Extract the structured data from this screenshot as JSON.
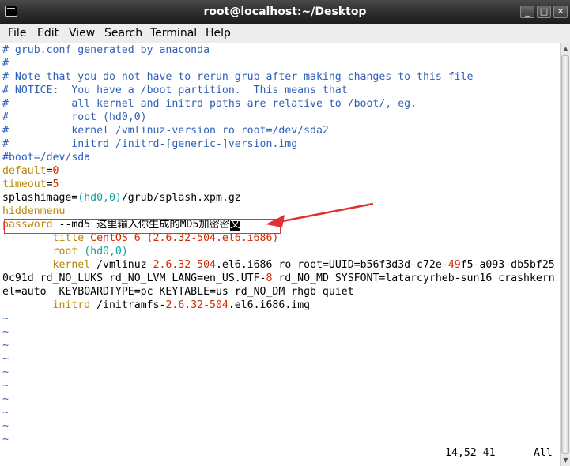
{
  "window": {
    "title": "root@localhost:~/Desktop",
    "controls": [
      "_",
      "□",
      "✕"
    ]
  },
  "menu": [
    "File",
    "Edit",
    "View",
    "Search",
    "Terminal",
    "Help"
  ],
  "lines": [
    [
      {
        "t": "# grub.conf generated by anaconda",
        "c": "c"
      }
    ],
    [
      {
        "t": "#",
        "c": "c"
      }
    ],
    [
      {
        "t": "# Note that you do not have to rerun grub after making changes to this file",
        "c": "c"
      }
    ],
    [
      {
        "t": "# NOTICE:  You have a /boot partition.  This means that",
        "c": "c"
      }
    ],
    [
      {
        "t": "#          all kernel and initrd paths are relative to /boot/, eg.",
        "c": "c"
      }
    ],
    [
      {
        "t": "#          root (hd0,0)",
        "c": "c"
      }
    ],
    [
      {
        "t": "#          kernel /vmlinuz-version ro root=/dev/sda2",
        "c": "c"
      }
    ],
    [
      {
        "t": "#          initrd /initrd-[generic-]version.img",
        "c": "c"
      }
    ],
    [
      {
        "t": "#boot=/dev/sda",
        "c": "c"
      }
    ],
    [
      {
        "t": "default",
        "c": "y"
      },
      {
        "t": "=",
        "c": ""
      },
      {
        "t": "0",
        "c": "m"
      }
    ],
    [
      {
        "t": "timeout",
        "c": "y"
      },
      {
        "t": "=",
        "c": ""
      },
      {
        "t": "5",
        "c": "m"
      }
    ],
    [
      {
        "t": "splashimage=",
        "c": ""
      },
      {
        "t": "(hd0,0)",
        "c": "t"
      },
      {
        "t": "/grub/splash.xpm.gz",
        "c": ""
      }
    ],
    [
      {
        "t": "hiddenmenu",
        "c": "y"
      }
    ],
    [
      {
        "t": "password",
        "c": "y"
      },
      {
        "t": " --md5 这里输入你生成的MD5加密密",
        "c": ""
      },
      {
        "t": "文",
        "c": "cur"
      }
    ],
    [
      {
        "t": "        ",
        "c": ""
      },
      {
        "t": "title",
        "c": "y"
      },
      {
        "t": " CentOS 6 (2.6.32-504.el6.i686)",
        "c": "m"
      }
    ],
    [
      {
        "t": "        ",
        "c": ""
      },
      {
        "t": "root",
        "c": "y"
      },
      {
        "t": " (hd0,0)",
        "c": "t"
      }
    ],
    [
      {
        "t": "        ",
        "c": ""
      },
      {
        "t": "kernel",
        "c": "y"
      },
      {
        "t": " /vmlinuz-",
        "c": ""
      },
      {
        "t": "2.6.32-504",
        "c": "m"
      },
      {
        "t": ".el6.i686 ro root=UUID=b56f3d3d-c72e-",
        "c": ""
      },
      {
        "t": "49",
        "c": "m"
      },
      {
        "t": "f5-a093-db5bf25",
        "c": ""
      }
    ],
    [
      {
        "t": "0c91d rd_NO_LUKS rd_NO_LVM LANG=en_US.UTF-",
        "c": ""
      },
      {
        "t": "8",
        "c": "m"
      },
      {
        "t": " rd_NO_MD SYSFONT=latarcyrheb-sun16 crashkern",
        "c": ""
      }
    ],
    [
      {
        "t": "el=auto  KEYBOARDTYPE=pc KEYTABLE=us rd_NO_DM rhgb quiet",
        "c": ""
      }
    ],
    [
      {
        "t": "        ",
        "c": ""
      },
      {
        "t": "initrd",
        "c": "y"
      },
      {
        "t": " /initramfs-",
        "c": ""
      },
      {
        "t": "2.6.32-504",
        "c": "m"
      },
      {
        "t": ".el6.i686.img",
        "c": ""
      }
    ]
  ],
  "tilde_rows": [
    "~",
    "~",
    "~",
    "~",
    "~",
    "~",
    "~",
    "~",
    "~",
    "~"
  ],
  "status": {
    "position": "14,52-41",
    "scope": "All"
  }
}
